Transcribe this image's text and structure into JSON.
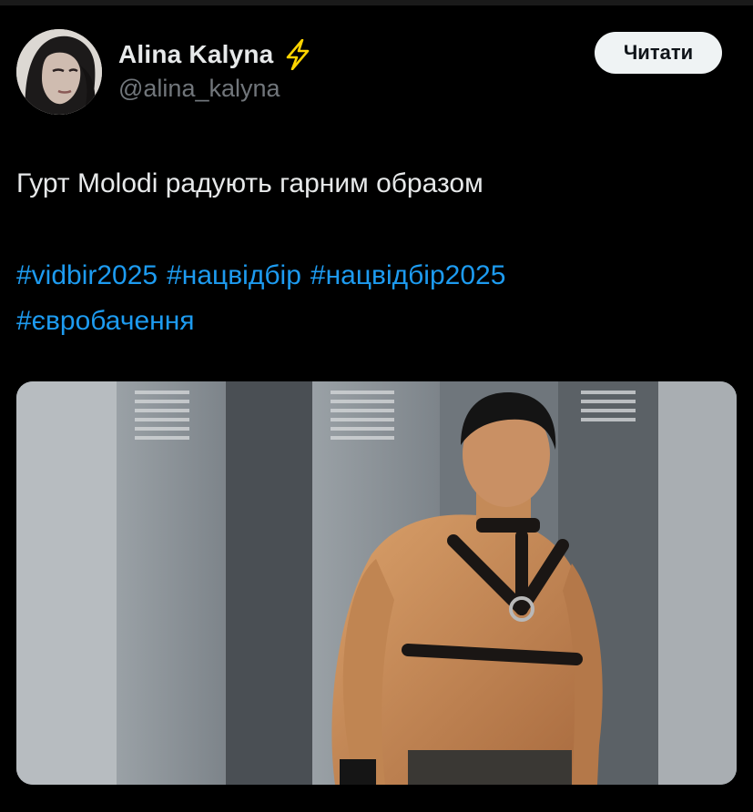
{
  "author": {
    "display_name": "Alina Kalyna",
    "handle": "@alina_kalyna",
    "badge_icon": "lightning-bolt-icon"
  },
  "follow_button": {
    "label": "Читати"
  },
  "tweet": {
    "text": "Гурт Molodi радують гарним образом",
    "hashtags": [
      "#vidbir2025",
      "#нацвідбір",
      "#нацвідбір2025",
      "#євробачення"
    ]
  },
  "colors": {
    "background": "#000000",
    "text": "#e7e9ea",
    "handle": "#71767b",
    "link": "#1d9bf0",
    "badge": "#ffd400",
    "button_bg": "#eff3f4"
  }
}
